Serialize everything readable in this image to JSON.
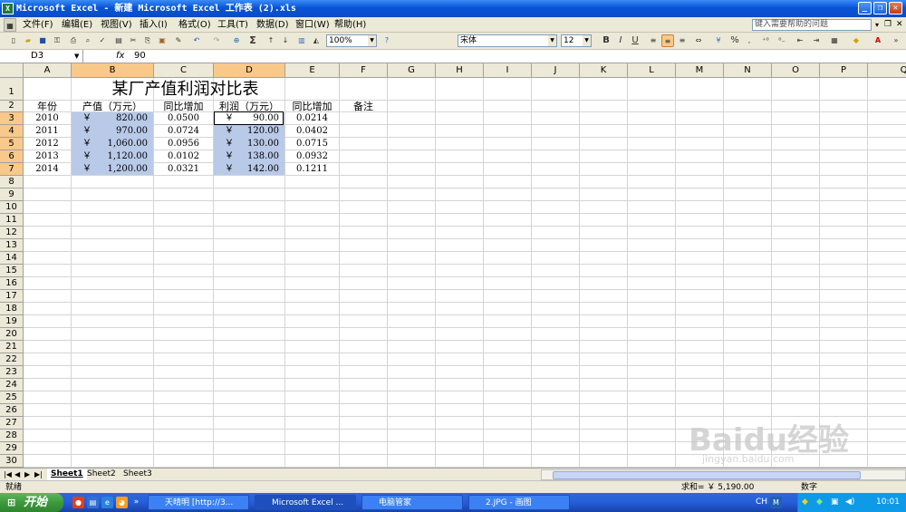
{
  "window": {
    "title": "Microsoft Excel - 新建 Microsoft Excel 工作表 (2).xls",
    "app_icon": "excel-icon",
    "min": "_",
    "restore": "❐",
    "close": "✕"
  },
  "menu": [
    "文件(F)",
    "编辑(E)",
    "视图(V)",
    "插入(I)",
    "格式(O)",
    "工具(T)",
    "数据(D)",
    "窗口(W)",
    "帮助(H)"
  ],
  "help_placeholder": "键入需要帮助的问题",
  "toolbar": {
    "zoom": "100%",
    "font": "宋体",
    "size": "12",
    "bold": "B",
    "italic": "I",
    "underline": "U",
    "sigma": "Σ",
    "percent": "%"
  },
  "formula_bar": {
    "name_box": "D3",
    "fx": "fx",
    "value": "90"
  },
  "columns": [
    "A",
    "B",
    "C",
    "D",
    "E",
    "F",
    "G",
    "H",
    "I",
    "J",
    "K",
    "L",
    "M",
    "N",
    "O",
    "P",
    "Q"
  ],
  "rows": [
    "1",
    "2",
    "3",
    "4",
    "5",
    "6",
    "7",
    "8",
    "9",
    "10",
    "11",
    "12",
    "13",
    "14",
    "15",
    "16",
    "17",
    "18",
    "19",
    "20",
    "21",
    "22",
    "23",
    "24",
    "25",
    "26",
    "27",
    "28",
    "29",
    "30"
  ],
  "sheet": {
    "title": "某厂产值利润对比表",
    "headers": [
      "年份",
      "产值（万元）",
      "同比增加",
      "利润（万元）",
      "同比增加",
      "备注"
    ],
    "currency": "￥",
    "data": [
      [
        "2010",
        "820.00",
        "0.0500",
        "90.00",
        "0.0214"
      ],
      [
        "2011",
        "970.00",
        "0.0724",
        "120.00",
        "0.0402"
      ],
      [
        "2012",
        "1,060.00",
        "0.0956",
        "130.00",
        "0.0715"
      ],
      [
        "2013",
        "1,120.00",
        "0.0102",
        "138.00",
        "0.0932"
      ],
      [
        "2014",
        "1,200.00",
        "0.0321",
        "142.00",
        "0.1211"
      ]
    ]
  },
  "sheet_tabs": [
    "Sheet1",
    "Sheet2",
    "Sheet3"
  ],
  "status": {
    "left": "就绪",
    "sum": "求和= ￥ 5,190.00",
    "mode": "数字"
  },
  "taskbar": {
    "start": "开始",
    "tasks": [
      "天晴明 [http://3...",
      "Microsoft Excel ...",
      "电脑管家",
      "2.JPG - 画图"
    ],
    "ime": "CH",
    "clock": "10:01"
  },
  "watermark": {
    "brand": "Baidu经验",
    "url": "jingyan.baidu.com"
  }
}
